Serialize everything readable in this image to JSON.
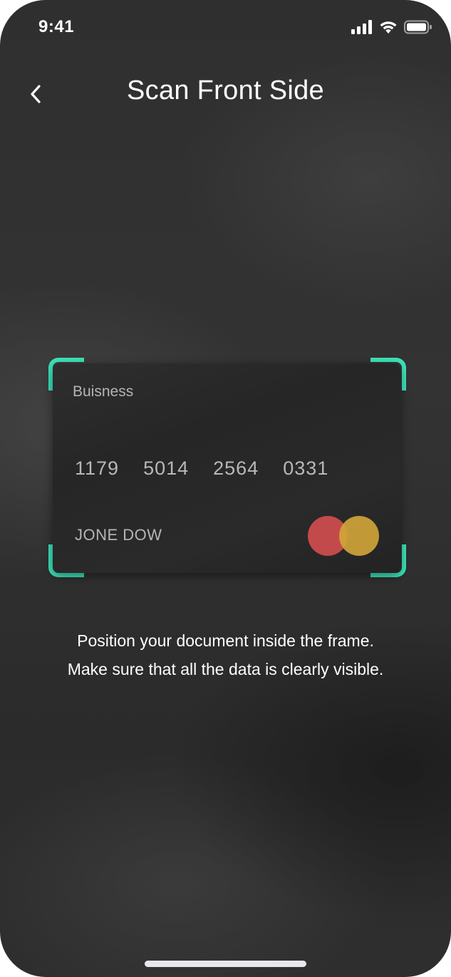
{
  "status_bar": {
    "time": "9:41",
    "icons": [
      "cellular-signal-icon",
      "wifi-icon",
      "battery-icon"
    ]
  },
  "header": {
    "back_icon": "chevron-left-icon",
    "title": "Scan Front Side"
  },
  "scan_frame": {
    "accent_color": "#3ce3b8"
  },
  "card": {
    "type_label": "Buisness",
    "number_groups": [
      "1179",
      "5014",
      "2564",
      "0331"
    ],
    "holder_name": "JONE DOW",
    "logo": "mastercard-logo",
    "logo_colors": [
      "#c34a4a",
      "#d4a63a"
    ]
  },
  "instructions": {
    "line1": "Position your document inside the frame.",
    "line2": "Make sure that all the data is clearly visible."
  }
}
